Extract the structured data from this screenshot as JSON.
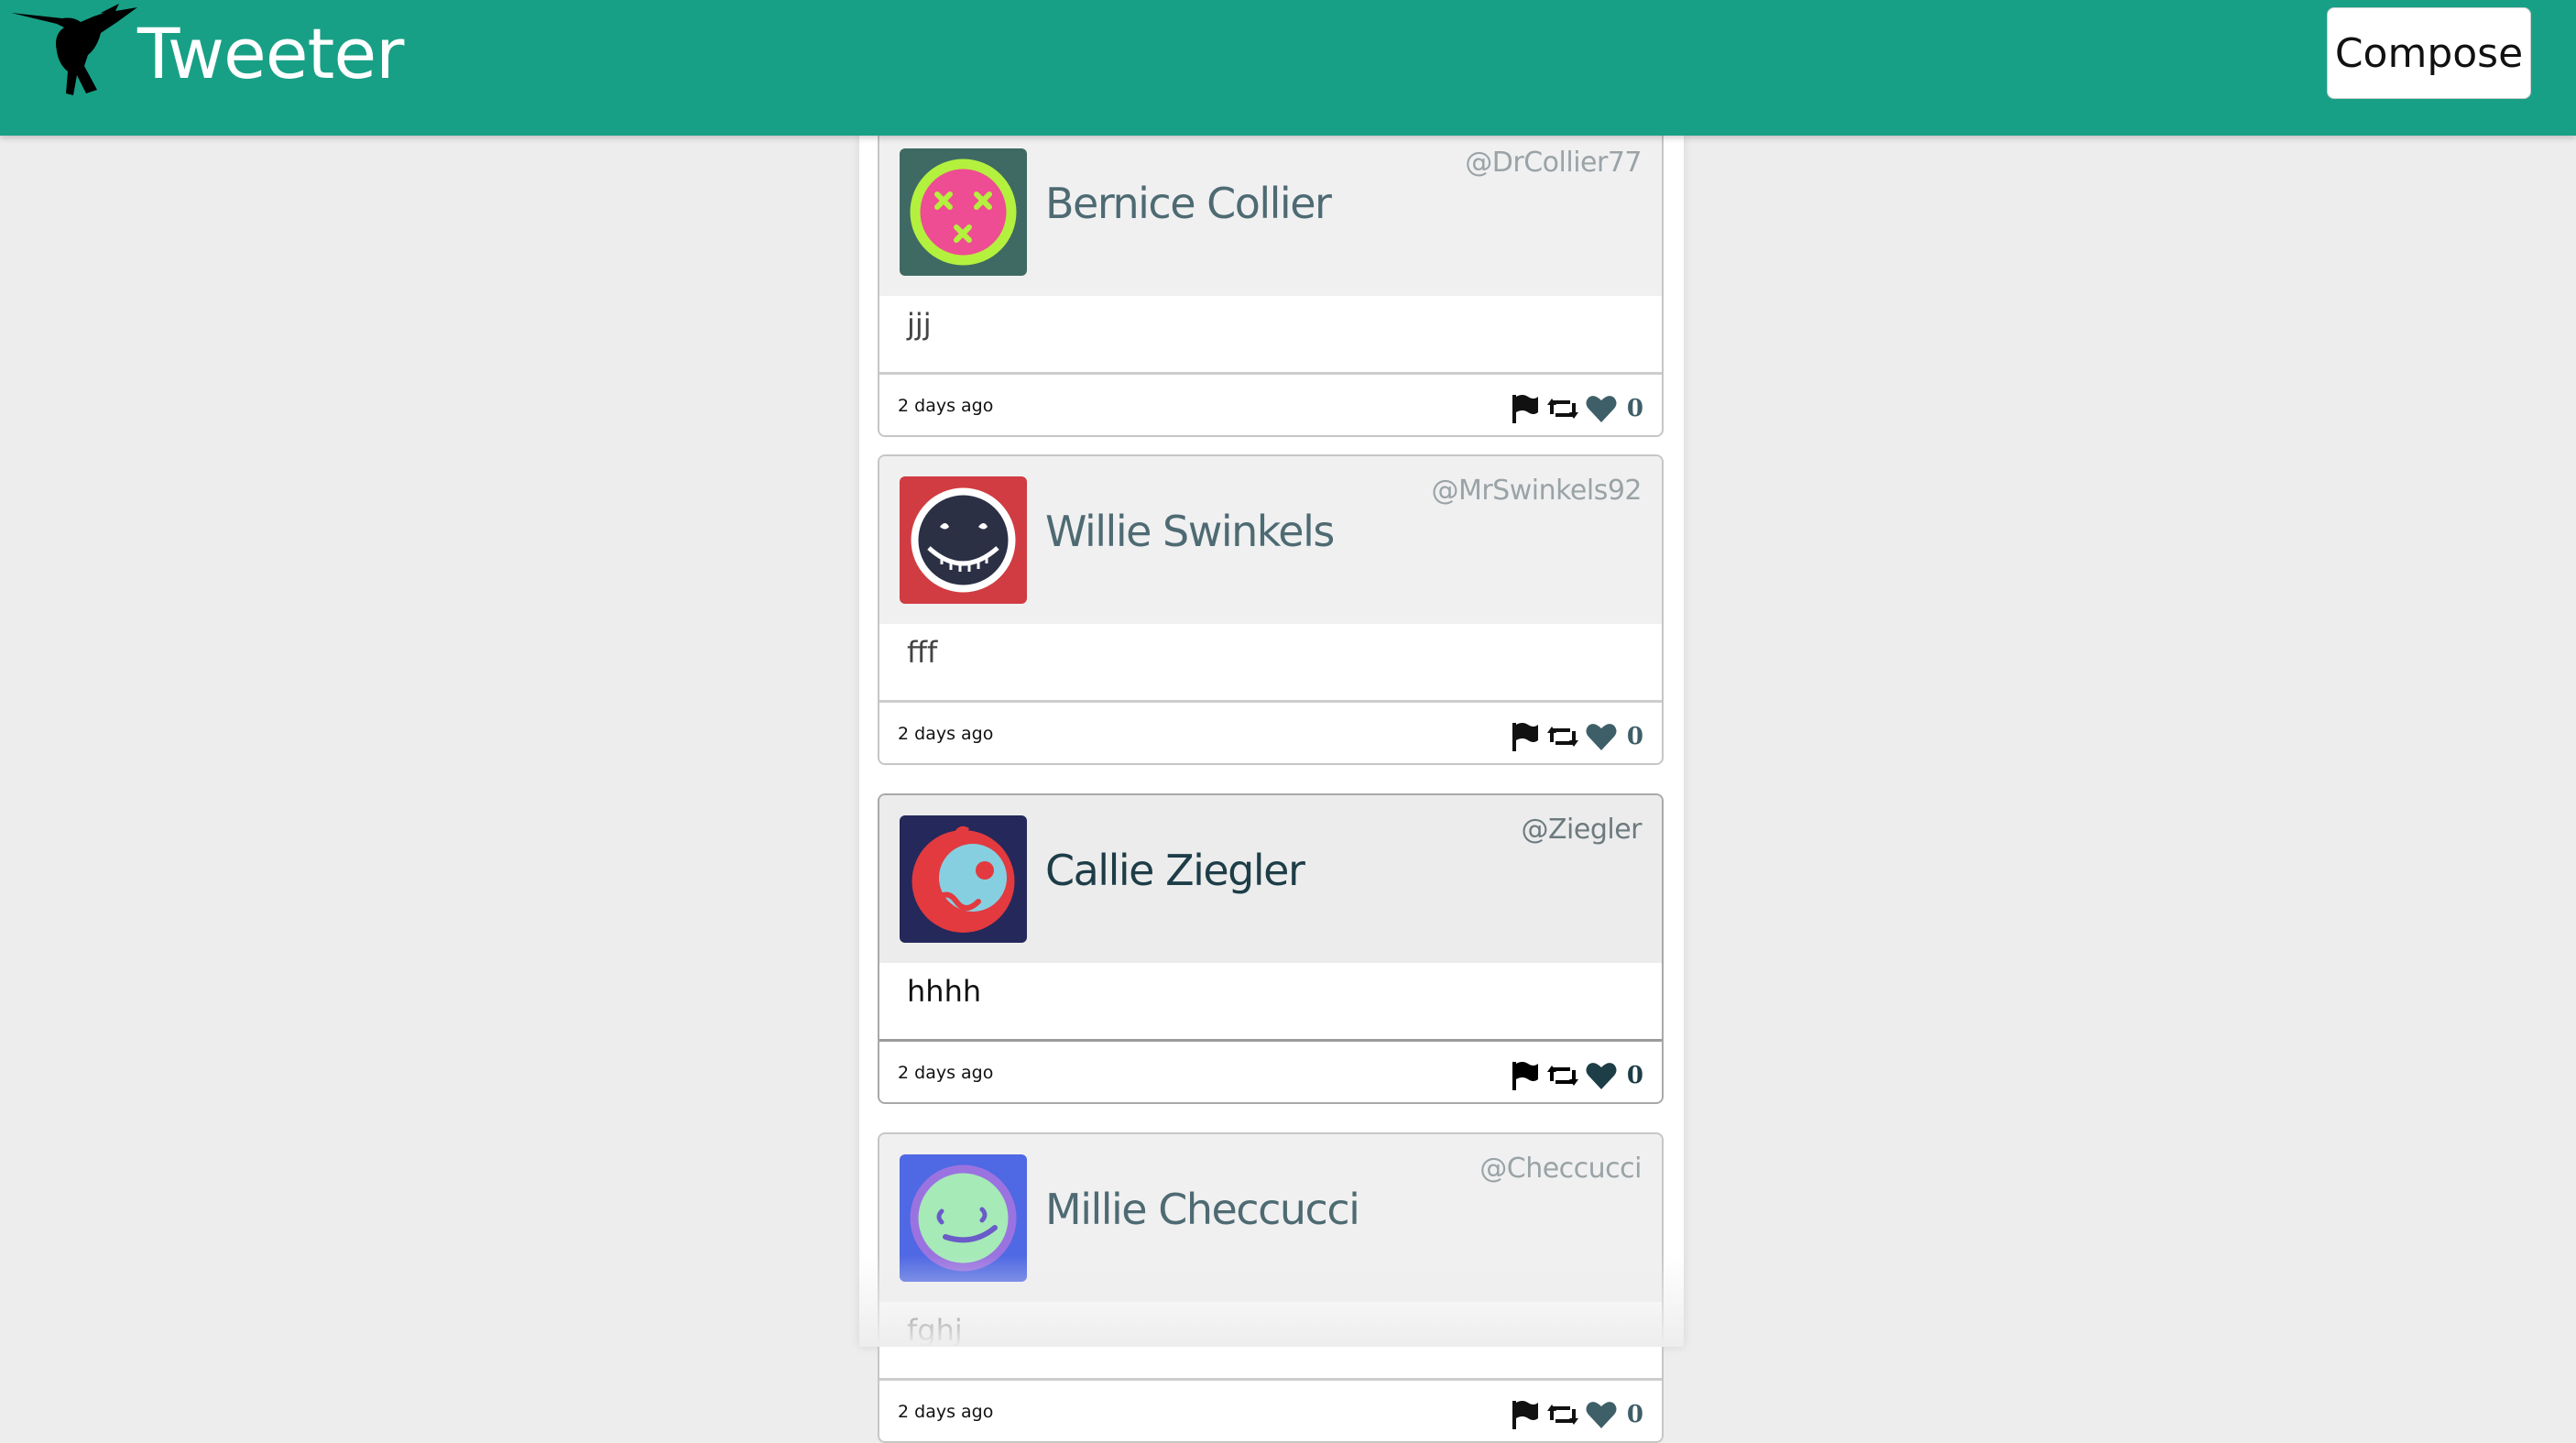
{
  "nav": {
    "logo_icon": "hummingbird-icon",
    "title": "Tweeter",
    "compose_label": "Compose",
    "background": "#18a086"
  },
  "tweets": [
    {
      "name": "Bernice Collier",
      "handle": "@DrCollier77",
      "content": "jjj",
      "time": "2 days ago",
      "likes": "0",
      "avatar_icon": "dizzy-face-icon",
      "avatar_bg": "#3e6a63"
    },
    {
      "name": "Willie Swinkels",
      "handle": "@MrSwinkels92",
      "content": "fff",
      "time": "2 days ago",
      "likes": "0",
      "avatar_icon": "grinning-ghost-icon",
      "avatar_bg": "#d03c42"
    },
    {
      "name": "Callie Ziegler",
      "handle": "@Ziegler",
      "content": "hhhh",
      "time": "2 days ago",
      "likes": "0",
      "avatar_icon": "wavy-mouth-face-icon",
      "avatar_bg": "#24285a"
    },
    {
      "name": "Millie Checcucci",
      "handle": "@Checcucci",
      "content": "fghj",
      "time": "2 days ago",
      "likes": "0",
      "avatar_icon": "smirk-face-icon",
      "avatar_bg": "#4f68e3"
    }
  ]
}
